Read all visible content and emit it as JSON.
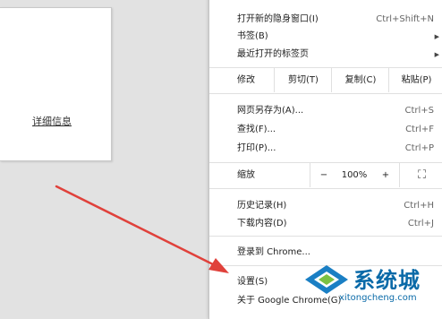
{
  "left_panel": {
    "details_link": "详细信息"
  },
  "menu": {
    "items_top": [
      {
        "label": "打开新的隐身窗口(I)",
        "shortcut": "Ctrl+Shift+N"
      },
      {
        "label": "书签(B)",
        "arrow": "▶"
      },
      {
        "label": "最近打开的标签页",
        "arrow": "▶"
      }
    ],
    "edit_row": {
      "label": "修改",
      "cut": "剪切(T)",
      "copy": "复制(C)",
      "paste": "粘贴(P)"
    },
    "items_mid": [
      {
        "label": "网页另存为(A)...",
        "shortcut": "Ctrl+S"
      },
      {
        "label": "查找(F)...",
        "shortcut": "Ctrl+F"
      },
      {
        "label": "打印(P)...",
        "shortcut": "Ctrl+P"
      }
    ],
    "zoom_row": {
      "label": "缩放",
      "minus": "−",
      "value": "100%",
      "plus": "+",
      "fullscreen": "⛶"
    },
    "items_history": [
      {
        "label": "历史记录(H)",
        "shortcut": "Ctrl+H"
      },
      {
        "label": "下载内容(D)",
        "shortcut": "Ctrl+J"
      }
    ],
    "signin": "登录到 Chrome...",
    "settings": "设置(S)",
    "about": "关于 Google Chrome(G)"
  },
  "watermark": {
    "brand": "系统城",
    "url": "xitongcheng.com",
    "colors": {
      "blue": "#1a7fc4",
      "green": "#7bc143"
    }
  },
  "annotation_arrow_color": "#e0413b"
}
